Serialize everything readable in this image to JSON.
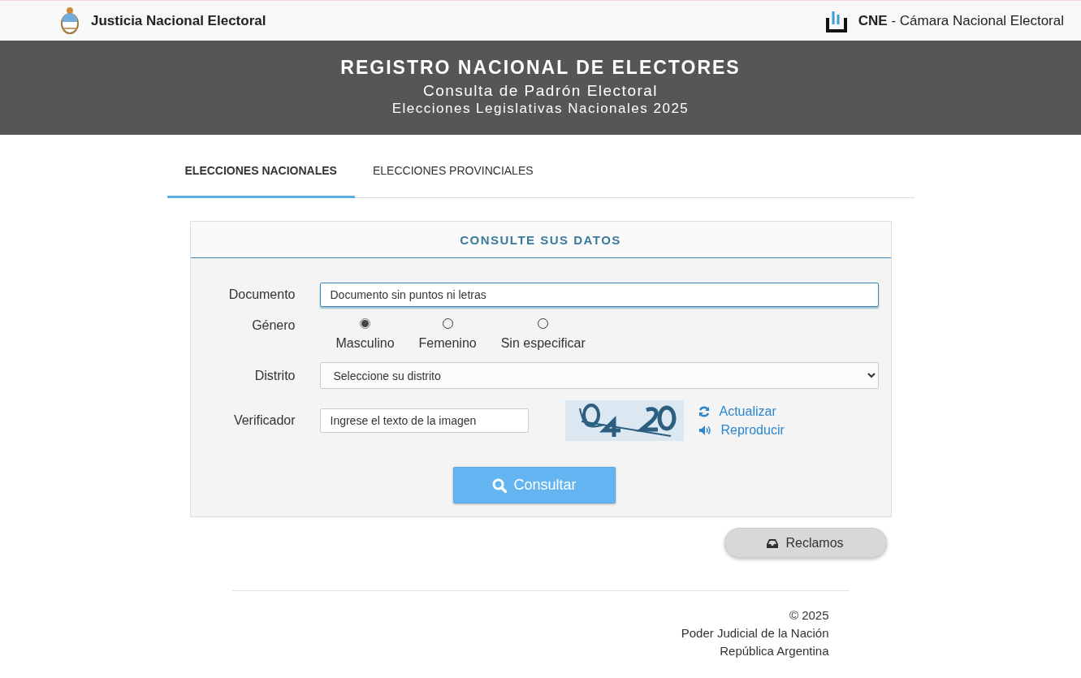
{
  "topbar": {
    "left_title": "Justicia Nacional Electoral",
    "right_title": "**CNE** - Cámara Nacional Electoral"
  },
  "banner": {
    "title": "REGISTRO NACIONAL DE ELECTORES",
    "subtitle": "Consulta de Padrón Electoral",
    "election": "Elecciones Legislativas Nacionales 2025"
  },
  "tabs": [
    {
      "label": "ELECCIONES NACIONALES",
      "selected": true
    },
    {
      "label": "ELECCIONES PROVINCIALES",
      "selected": false
    }
  ],
  "form": {
    "title": "CONSULTE SUS DATOS",
    "documento": {
      "label": "Documento",
      "placeholder": "Documento sin puntos ni letras"
    },
    "genero": {
      "label": "Género",
      "options": [
        {
          "label": "Masculino",
          "selected": true
        },
        {
          "label": "Femenino",
          "selected": false
        },
        {
          "label": "Sin especificar",
          "selected": false
        }
      ]
    },
    "distrito": {
      "label": "Distrito",
      "value": "Seleccione su distrito"
    },
    "verificador": {
      "label": "Verificador",
      "placeholder": "Ingrese el texto de la imagen",
      "refresh_link": "Actualizar",
      "audio_link": "Reproducir"
    },
    "submit": "Consultar"
  },
  "claims_button": "Reclamos",
  "footer": [
    "© 2025",
    "Poder Judicial de la Nación",
    "República Argentina"
  ]
}
